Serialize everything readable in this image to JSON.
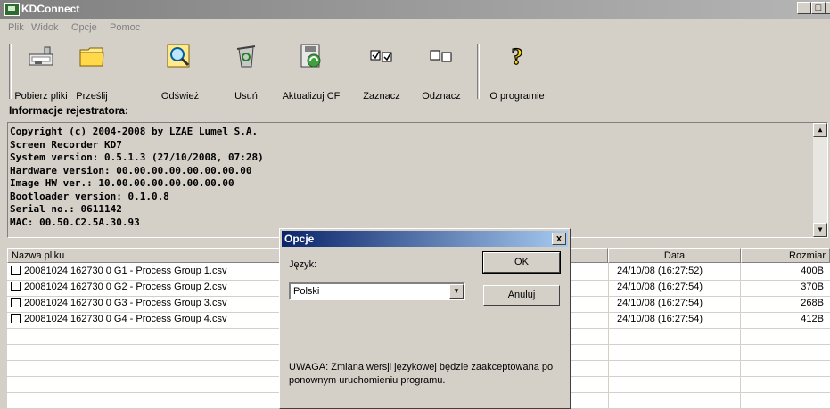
{
  "window": {
    "title": "KDConnect",
    "min_glyph": "_",
    "max_glyph": "□",
    "close_glyph": "x"
  },
  "menu": [
    "Plik",
    "Widok",
    "Opcje",
    "Pomoc"
  ],
  "toolbar": [
    "Pobierz pliki",
    "Prześlij",
    "Odśwież",
    "Usuń",
    "Aktualizuj CF",
    "Zaznacz",
    "Odznacz",
    "O programie"
  ],
  "info": {
    "label": "Informacje rejestratora:",
    "lines": [
      "Copyright (c) 2004-2008 by LZAE Lumel S.A.",
      "Screen Recorder KD7",
      "System version: 0.5.1.3 (27/10/2008, 07:28)",
      "Hardware version: 00.00.00.00.00.00.00.00",
      "Image HW ver.: 10.00.00.00.00.00.00.00",
      "Bootloader version: 0.1.0.8",
      "Serial no.: 0611142",
      "MAC: 00.50.C2.5A.30.93"
    ]
  },
  "table": {
    "headers": [
      "Nazwa pliku",
      "Data",
      "Rozmiar"
    ],
    "rows": [
      [
        "20081024 162730 0 G1 - Process Group 1.csv",
        "24/10/08 (16:27:52)",
        "400B"
      ],
      [
        "20081024 162730 0 G2 - Process Group 2.csv",
        "24/10/08 (16:27:54)",
        "370B"
      ],
      [
        "20081024 162730 0 G3 - Process Group 3.csv",
        "24/10/08 (16:27:54)",
        "268B"
      ],
      [
        "20081024 162730 0 G4 - Process Group 4.csv",
        "24/10/08 (16:27:54)",
        "412B"
      ]
    ]
  },
  "dialog": {
    "title": "Opcje",
    "close_glyph": "x",
    "language_label": "Język:",
    "language_value": "Polski",
    "ok": "OK",
    "cancel": "Anuluj",
    "warning": "UWAGA: Zmiana wersji językowej będzie zaakceptowana po ponownym uruchomieniu programu."
  },
  "icons": [
    "download-icon",
    "folder-icon",
    "magnifier-icon",
    "recycle-bin-icon",
    "update-card-icon",
    "checked-boxes-icon",
    "empty-boxes-icon",
    "question-mark-icon"
  ]
}
